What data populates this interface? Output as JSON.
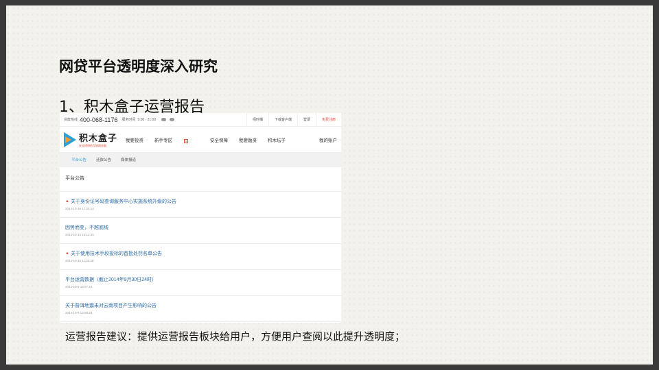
{
  "slide": {
    "title": "网贷平台透明度深入研究",
    "subtitle": "1、积木盒子运营报告",
    "caption": "运营报告建议：提供运营报告板块给用户，方便用户查阅以此提升透明度；"
  },
  "site": {
    "topbar": {
      "hotline_label": "贷款热线",
      "phone": "400-068-1176",
      "hours_label": "服务时间",
      "hours": "9:00 - 21:00",
      "social_icons": [
        "weibo-icon",
        "wechat-icon"
      ],
      "links": [
        {
          "label": "招时捕",
          "highlight": false
        },
        {
          "label": "下载客户端",
          "highlight": false
        },
        {
          "label": "登录",
          "highlight": false
        },
        {
          "label": "免费注册",
          "highlight": true
        }
      ]
    },
    "logo": {
      "name": "积木盒子",
      "slogan": "安全透明的互联网金融"
    },
    "nav": {
      "items": [
        "我要投资",
        "新手专区",
        "安全保障",
        "我要融资",
        "积木坛子"
      ],
      "badge": "1",
      "account": "我的账户"
    },
    "subtabs": {
      "items": [
        "平台公告",
        "还款公告",
        "媒体报道"
      ],
      "active_index": 0
    },
    "section_title": "平台公告",
    "notices": [
      {
        "title": "关于身份证号码查询服务中心实施系统升级的公告",
        "date": "2014-10-16 17:24:14",
        "flame": true
      },
      {
        "title": "因势而变，不越底线",
        "date": "2014-10-15 15:13:35",
        "flame": false
      },
      {
        "title": "关于使用技术手段投标的首批处罚名单公告",
        "date": "2014-10-15 11:44:28",
        "flame": true
      },
      {
        "title": "平台运营数据（截止2014年9月30日24时）",
        "date": "2014-10-9 18:07:24",
        "flame": false
      },
      {
        "title": "关于普洱地震未对云南项目产生影响的公告",
        "date": "2014-10-8 13:09:23",
        "flame": false
      }
    ]
  }
}
